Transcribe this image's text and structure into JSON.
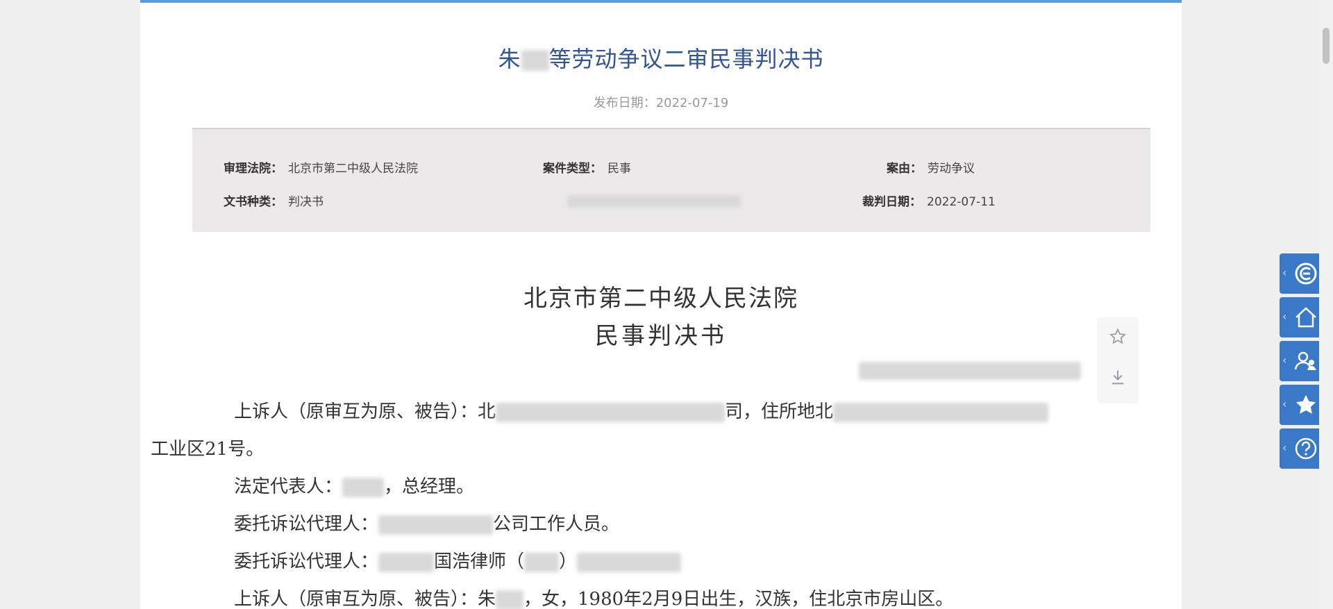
{
  "document": {
    "title_prefix": "朱",
    "title_suffix": "等劳动争议二审民事判决书",
    "publish_label": "发布日期：",
    "publish_date": "2022-07-19"
  },
  "info": {
    "court_label": "审理法院：",
    "court_value": "北京市第二中级人民法院",
    "case_type_label": "案件类型：",
    "case_type_value": "民事",
    "cause_label": "案由：",
    "cause_value": "劳动争议",
    "doc_type_label": "文书种类：",
    "doc_type_value": "判决书",
    "judge_date_label": "裁判日期：",
    "judge_date_value": "2022-07-11"
  },
  "body": {
    "court_name": "北京市第二中级人民法院",
    "doc_kind": "民事判决书",
    "p1_start": "上诉人（原审互为原、被告）：北",
    "p1_mid": "司，住所地北",
    "p1_end": "工业区21号。",
    "p2_start": "法定代表人：",
    "p2_end": "，总经理。",
    "p3_start": "委托诉讼代理人：",
    "p3_end": "公司工作人员。",
    "p4_start": "委托诉讼代理人：",
    "p4_mid": "国浩律师（",
    "p4_end": "）",
    "p5_start": "上诉人（原审互为原、被告）：朱",
    "p5_end": "，女，1980年2月9日出生，汉族，住北京市房山区。"
  },
  "icons": {
    "favorite": "star-outline-icon",
    "download": "download-icon",
    "side": [
      "logo-icon",
      "home-icon",
      "user-icon",
      "star-icon",
      "help-icon"
    ]
  },
  "colors": {
    "accent": "#3a78c8",
    "title": "#2f5597",
    "top_border": "#5b9be0"
  }
}
